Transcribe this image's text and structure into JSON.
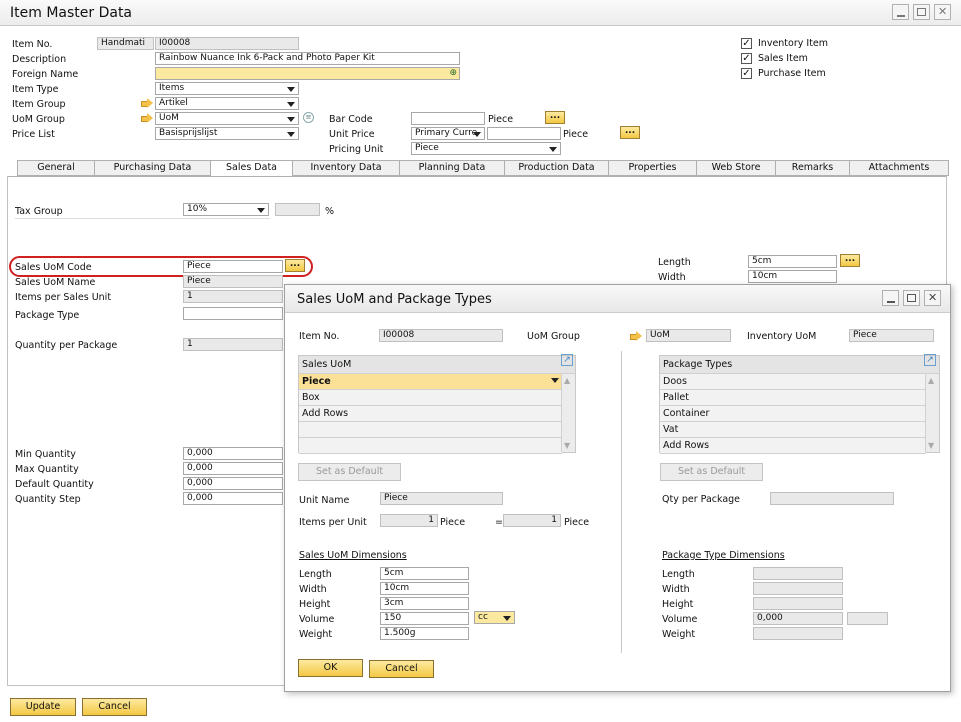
{
  "window": {
    "title": "Item Master Data"
  },
  "header": {
    "item_no_label": "Item No.",
    "item_no_series": "Handmati",
    "item_no": "I00008",
    "description_label": "Description",
    "description": "Rainbow Nuance Ink 6-Pack and Photo Paper Kit",
    "foreign_name_label": "Foreign Name",
    "item_type_label": "Item Type",
    "item_type": "Items",
    "item_group_label": "Item Group",
    "item_group": "Artikel",
    "uom_group_label": "UoM Group",
    "uom_group": "UoM",
    "price_list_label": "Price List",
    "price_list": "Basisprijslijst",
    "bar_code_label": "Bar Code",
    "bar_code_unit": "Piece",
    "unit_price_label": "Unit Price",
    "unit_price_currency": "Primary Curre",
    "unit_price_unit": "Piece",
    "pricing_unit_label": "Pricing Unit",
    "pricing_unit": "Piece",
    "checks": [
      {
        "label": "Inventory Item",
        "checked": true
      },
      {
        "label": "Sales Item",
        "checked": true
      },
      {
        "label": "Purchase Item",
        "checked": true
      }
    ]
  },
  "tabs": [
    "General",
    "Purchasing Data",
    "Sales Data",
    "Inventory Data",
    "Planning Data",
    "Production Data",
    "Properties",
    "Web Store",
    "Remarks",
    "Attachments"
  ],
  "sales": {
    "tax_group_label": "Tax Group",
    "tax_group": "10%",
    "tax_pct": "%",
    "sales_uom_code_label": "Sales UoM Code",
    "sales_uom_code": "Piece",
    "sales_uom_name_label": "Sales UoM Name",
    "sales_uom_name": "Piece",
    "items_per_unit_label": "Items per Sales Unit",
    "items_per_unit": "1",
    "package_type_label": "Package Type",
    "qty_per_package_label": "Quantity per Package",
    "qty_per_package": "1",
    "length_label": "Length",
    "length": "5cm",
    "width_label": "Width",
    "width": "10cm",
    "min_qty_label": "Min Quantity",
    "min_qty": "0,000",
    "max_qty_label": "Max Quantity",
    "max_qty": "0,000",
    "default_qty_label": "Default Quantity",
    "default_qty": "0,000",
    "qty_step_label": "Quantity Step",
    "qty_step": "0,000"
  },
  "footer": {
    "update": "Update",
    "cancel": "Cancel"
  },
  "dialog": {
    "title": "Sales UoM and Package Types",
    "item_no_label": "Item No.",
    "item_no": "I00008",
    "uom_group_label": "UoM Group",
    "uom_group": "UoM",
    "inventory_uom_label": "Inventory UoM",
    "inventory_uom": "Piece",
    "sales_uom_header": "Sales UoM",
    "sales_uom_rows": [
      "Piece",
      "Box",
      "Add Rows"
    ],
    "package_types_header": "Package Types",
    "package_rows": [
      "Doos",
      "Pallet",
      "Container",
      "Vat",
      "Add Rows"
    ],
    "set_default": "Set as Default",
    "unit_name_label": "Unit Name",
    "unit_name": "Piece",
    "items_per_unit_label": "Items per Unit",
    "ipu_left_val": "1",
    "ipu_left_unit": "Piece",
    "equals": "=",
    "ipu_right_val": "1",
    "ipu_right_unit": "Piece",
    "qty_per_package_label": "Qty per Package",
    "sales_dims_title": "Sales UoM Dimensions",
    "sales_dims": [
      {
        "label": "Length",
        "value": "5cm"
      },
      {
        "label": "Width",
        "value": "10cm"
      },
      {
        "label": "Height",
        "value": "3cm"
      },
      {
        "label": "Volume",
        "value": "150"
      },
      {
        "label": "Weight",
        "value": "1.500g"
      }
    ],
    "volume_unit": "cc",
    "pkg_dims_title": "Package Type Dimensions",
    "pkg_dims": [
      {
        "label": "Length",
        "value": ""
      },
      {
        "label": "Width",
        "value": ""
      },
      {
        "label": "Height",
        "value": ""
      },
      {
        "label": "Volume",
        "value": "0,000"
      },
      {
        "label": "Weight",
        "value": ""
      }
    ],
    "ok": "OK",
    "cancel": "Cancel"
  },
  "colors": {
    "accent": "#f3c844",
    "highlight": "#d02020"
  }
}
